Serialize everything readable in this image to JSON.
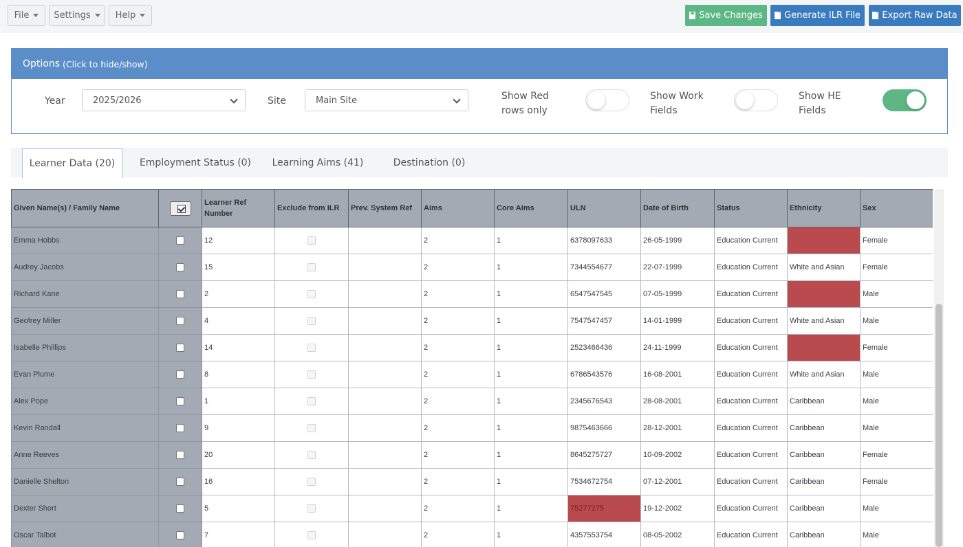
{
  "menu": {
    "file": "File",
    "settings": "Settings",
    "help": "Help"
  },
  "actions": {
    "save": "Save Changes",
    "generate": "Generate ILR File",
    "export": "Export Raw Data"
  },
  "options": {
    "title": "Options",
    "hint": "(Click to hide/show)",
    "year_label": "Year",
    "year_value": "2025/2026",
    "site_label": "Site",
    "site_value": "Main Site",
    "show_red_line1": "Show Red",
    "show_red_line2": "rows only",
    "show_red_on": false,
    "show_work_line1": "Show Work",
    "show_work_line2": "Fields",
    "show_work_on": false,
    "show_he_line1": "Show HE",
    "show_he_line2": "Fields",
    "show_he_on": true
  },
  "tabs": [
    {
      "label": "Learner Data (20)",
      "active": true
    },
    {
      "label": "Employment Status (0)",
      "active": false
    },
    {
      "label": "Learning Aims (41)",
      "active": false
    },
    {
      "label": "Destination (0)",
      "active": false
    }
  ],
  "columns": {
    "name": "Given Name(s) / Family Name",
    "ref_line1": "Learner Ref",
    "ref_line2": "Number",
    "exclude": "Exclude from ILR",
    "prev": "Prev. System Ref",
    "aims": "Aims",
    "core": "Core Aims",
    "uln": "ULN",
    "dob": "Date of Birth",
    "status": "Status",
    "ethnicity": "Ethnicity",
    "sex": "Sex"
  },
  "highlight_color": "#b94a4d",
  "rows": [
    {
      "name": "Emma Hobbs",
      "ref": "12",
      "aims": "2",
      "core": "1",
      "uln": "6378097633",
      "dob": "26-05-1999",
      "status": "Education Current",
      "ethnicity": "",
      "sex": "Female",
      "uln_red": false,
      "eth_red": true
    },
    {
      "name": "Audrey Jacobs",
      "ref": "15",
      "aims": "2",
      "core": "1",
      "uln": "7344554677",
      "dob": "22-07-1999",
      "status": "Education Current",
      "ethnicity": "White and Asian",
      "sex": "Female",
      "uln_red": false,
      "eth_red": false
    },
    {
      "name": "Richard  Kane",
      "ref": "2",
      "aims": "2",
      "core": "1",
      "uln": "6547547545",
      "dob": "07-05-1999",
      "status": "Education Current",
      "ethnicity": "",
      "sex": "Male",
      "uln_red": false,
      "eth_red": true
    },
    {
      "name": "Geofrey Miller",
      "ref": "4",
      "aims": "2",
      "core": "1",
      "uln": "7547547457",
      "dob": "14-01-1999",
      "status": "Education Current",
      "ethnicity": "White and Asian",
      "sex": "Male",
      "uln_red": false,
      "eth_red": false
    },
    {
      "name": "Isabelle Phillips",
      "ref": "14",
      "aims": "2",
      "core": "1",
      "uln": "2523466436",
      "dob": "24-11-1999",
      "status": "Education Current",
      "ethnicity": "",
      "sex": "Female",
      "uln_red": false,
      "eth_red": true
    },
    {
      "name": "Evan Plume",
      "ref": "8",
      "aims": "2",
      "core": "1",
      "uln": "6786543576",
      "dob": "16-08-2001",
      "status": "Education Current",
      "ethnicity": "White and Asian",
      "sex": "Male",
      "uln_red": false,
      "eth_red": false
    },
    {
      "name": "Alex Pope",
      "ref": "1",
      "aims": "2",
      "core": "1",
      "uln": "2345676543",
      "dob": "28-08-2001",
      "status": "Education Current",
      "ethnicity": "Caribbean",
      "sex": "Male",
      "uln_red": false,
      "eth_red": false
    },
    {
      "name": "Kevin Randall",
      "ref": "9",
      "aims": "2",
      "core": "1",
      "uln": "9875463666",
      "dob": "28-12-2001",
      "status": "Education Current",
      "ethnicity": "Caribbean",
      "sex": "Male",
      "uln_red": false,
      "eth_red": false
    },
    {
      "name": "Anne Reeves",
      "ref": "20",
      "aims": "2",
      "core": "1",
      "uln": "8645275727",
      "dob": "10-09-2002",
      "status": "Education Current",
      "ethnicity": "Caribbean",
      "sex": "Female",
      "uln_red": false,
      "eth_red": false
    },
    {
      "name": "Danielle Shelton",
      "ref": "16",
      "aims": "2",
      "core": "1",
      "uln": "7534672754",
      "dob": "07-12-2001",
      "status": "Education Current",
      "ethnicity": "Caribbean",
      "sex": "Female",
      "uln_red": false,
      "eth_red": false
    },
    {
      "name": "Dexter Short",
      "ref": "5",
      "aims": "2",
      "core": "1",
      "uln": "75277275",
      "dob": "19-12-2002",
      "status": "Education Current",
      "ethnicity": "Caribbean",
      "sex": "Male",
      "uln_red": true,
      "eth_red": false
    },
    {
      "name": "Oscar Talbot",
      "ref": "7",
      "aims": "2",
      "core": "1",
      "uln": "4357553754",
      "dob": "08-05-2002",
      "status": "Education Current",
      "ethnicity": "Caribbean",
      "sex": "Male",
      "uln_red": false,
      "eth_red": false
    }
  ]
}
